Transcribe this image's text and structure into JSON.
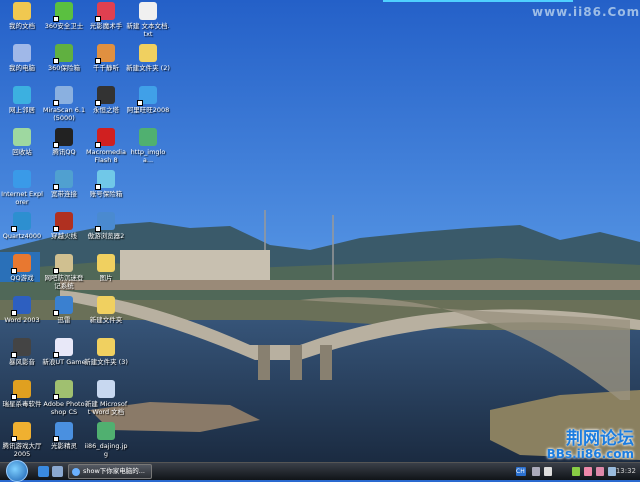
{
  "watermark": "www.ii86.Com",
  "brand": {
    "cn": "荆网论坛",
    "en": "BBs.ii86.com"
  },
  "desktop_icons": [
    {
      "label": "我的文档",
      "color": "#f0c850",
      "shortcut": false
    },
    {
      "label": "我的电脑",
      "color": "#a0b8e8",
      "shortcut": false
    },
    {
      "label": "网上邻居",
      "color": "#3cb0e0",
      "shortcut": false
    },
    {
      "label": "回收站",
      "color": "#9ed8a0",
      "shortcut": false
    },
    {
      "label": "Internet Explorer",
      "color": "#3a9ae8",
      "shortcut": false
    },
    {
      "label": "Quartz4000",
      "color": "#2d8fd0",
      "shortcut": true
    },
    {
      "label": "QQ游戏",
      "color": "#e87830",
      "shortcut": true
    },
    {
      "label": "Word 2003",
      "color": "#2d5fc0",
      "shortcut": true
    },
    {
      "label": "暴风影音",
      "color": "#444444",
      "shortcut": true
    },
    {
      "label": "瑞星杀毒软件",
      "color": "#e0a020",
      "shortcut": true
    },
    {
      "label": "腾讯游戏大厅 2005",
      "color": "#f0b030",
      "shortcut": true
    },
    {
      "label": "360安全卫士",
      "color": "#5ac040",
      "shortcut": true
    },
    {
      "label": "360保险箱",
      "color": "#60b040",
      "shortcut": true
    },
    {
      "label": "MiraScan 6.1 (5000)",
      "color": "#8ab0e0",
      "shortcut": true
    },
    {
      "label": "腾讯QQ",
      "color": "#222222",
      "shortcut": true
    },
    {
      "label": "宽带连接",
      "color": "#50a0d0",
      "shortcut": true
    },
    {
      "label": "穿越火线",
      "color": "#b03020",
      "shortcut": true
    },
    {
      "label": "网吧防沉迷登记系统",
      "color": "#d0c090",
      "shortcut": true
    },
    {
      "label": "迅雷",
      "color": "#3a80d0",
      "shortcut": true
    },
    {
      "label": "新浪UT Game",
      "color": "#e8e8f8",
      "shortcut": true
    },
    {
      "label": "Adobe Photoshop CS",
      "color": "#a0c070",
      "shortcut": true
    },
    {
      "label": "光影精灵",
      "color": "#4a90e0",
      "shortcut": true
    },
    {
      "label": "光影魔术手",
      "color": "#e04050",
      "shortcut": true
    },
    {
      "label": "千千静听",
      "color": "#e09040",
      "shortcut": true
    },
    {
      "label": "永恒之塔",
      "color": "#333333",
      "shortcut": true
    },
    {
      "label": "Macromedia Flash 8",
      "color": "#d02020",
      "shortcut": true
    },
    {
      "label": "账号保险箱",
      "color": "#70c8e8",
      "shortcut": true
    },
    {
      "label": "傲游浏览器2",
      "color": "#4a8ad0",
      "shortcut": true
    },
    {
      "label": "图片",
      "color": "#f0d060",
      "shortcut": false
    },
    {
      "label": "新建文件夹",
      "color": "#f0d060",
      "shortcut": false
    },
    {
      "label": "新建文件夹 (3)",
      "color": "#f0d060",
      "shortcut": false
    },
    {
      "label": "新建 Microsoft Word 文档",
      "color": "#c8d8f0",
      "shortcut": false
    },
    {
      "label": "ii86_dajing.jpg",
      "color": "#50b070",
      "shortcut": false
    },
    {
      "label": "新建 文本文档.txt",
      "color": "#f0f0f0",
      "shortcut": false
    },
    {
      "label": "新建文件夹 (2)",
      "color": "#f0d060",
      "shortcut": false
    },
    {
      "label": "阿里旺旺2008",
      "color": "#40a0e8",
      "shortcut": true
    },
    {
      "label": "http_imgloa...",
      "color": "#50b070",
      "shortcut": false
    }
  ],
  "taskbar": {
    "task_label": "show下你家电脑的...",
    "tray_lang": "CH",
    "clock": "13:32"
  }
}
